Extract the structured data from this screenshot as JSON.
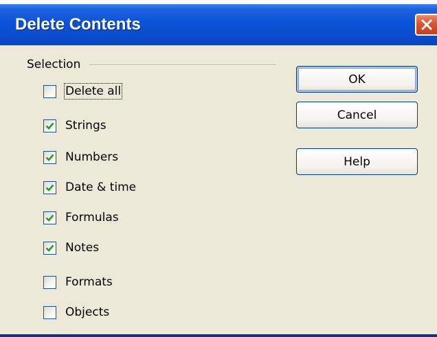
{
  "window": {
    "title": "Delete Contents",
    "close_icon": "close-icon"
  },
  "selection": {
    "frame_label": "Selection",
    "options": [
      {
        "label": "Delete all",
        "checked": false
      },
      {
        "label": "Strings",
        "checked": true
      },
      {
        "label": "Numbers",
        "checked": true
      },
      {
        "label": "Date & time",
        "checked": true
      },
      {
        "label": "Formulas",
        "checked": true
      },
      {
        "label": "Notes",
        "checked": true
      },
      {
        "label": "Formats",
        "checked": false
      },
      {
        "label": "Objects",
        "checked": false
      }
    ]
  },
  "buttons": {
    "ok": "OK",
    "cancel": "Cancel",
    "help": "Help"
  },
  "colors": {
    "titlebar": "#0c52d8",
    "dialog_bg": "#ece9d8",
    "checkmark": "#21a121",
    "close_button": "#d9532e"
  }
}
